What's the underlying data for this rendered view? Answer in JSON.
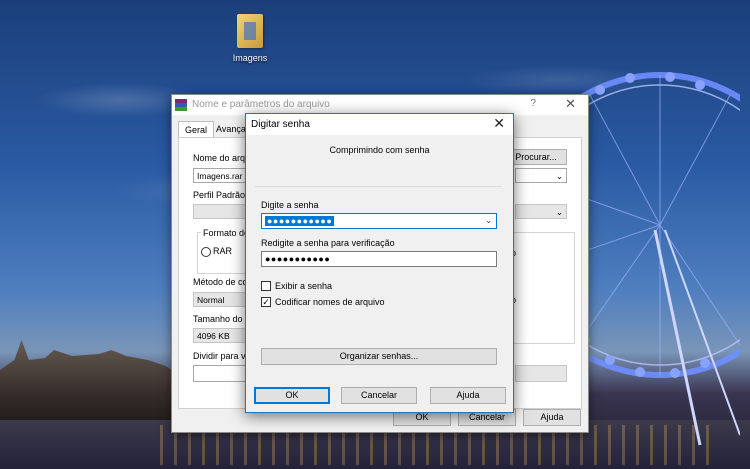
{
  "desktop": {
    "icon_label": "Imagens"
  },
  "back_dialog": {
    "title": "Nome e parâmetros do arquivo",
    "help": "?",
    "close": "✕",
    "tabs": [
      "Geral",
      "Avança"
    ],
    "archive_name_label": "Nome do arqu",
    "archive_name_value": "Imagens.rar",
    "browse_button": "Procurar...",
    "profile_label": "Perfil Padrão",
    "format_label": "Formato do",
    "format_option": "RAR",
    "method_label": "Método de co",
    "method_value": "Normal",
    "size_label": "Tamanho do d",
    "size_value": "4096 KB",
    "split_label": "Dividir para vo",
    "right_fragment_1": "o",
    "right_fragment_2": "o",
    "ok": "OK",
    "cancel": "Cancelar",
    "help_button": "Ajuda"
  },
  "password_dialog": {
    "title": "Digitar senha",
    "close": "✕",
    "subtitle": "Comprimindo com senha",
    "enter_label": "Digite a senha",
    "enter_value": "●●●●●●●●●●●",
    "reenter_label": "Redigite a senha para verificação",
    "reenter_value": "●●●●●●●●●●●",
    "show_password": {
      "label": "Exibir a senha",
      "checked": false
    },
    "encrypt_names": {
      "label": "Codificar nomes de arquivo",
      "checked": true
    },
    "organize_button": "Organizar senhas...",
    "ok": "OK",
    "cancel": "Cancelar",
    "help": "Ajuda"
  }
}
